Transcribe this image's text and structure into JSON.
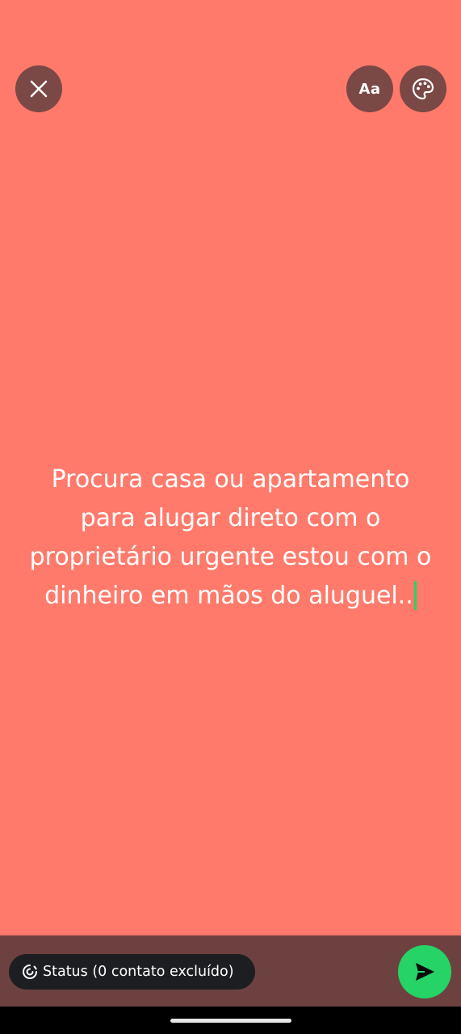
{
  "theme": {
    "background": "#FF7A6B",
    "button_bg": "#7A4845",
    "bottom_bar_bg": "#6D4140",
    "pill_bg": "#1C1E21",
    "accent": "#25D366"
  },
  "toolbar": {
    "close_icon": "close-icon",
    "font_button_label": "Aa",
    "palette_icon": "palette-icon"
  },
  "status_text": {
    "content": "Procura casa ou apartamento para alugar direto com o proprietário urgente estou com o dinheiro em mãos do aluguel.."
  },
  "footer": {
    "audience_label": "Status (0 contato excluído)",
    "audience_icon": "status-ring-icon",
    "send_icon": "send-icon"
  }
}
